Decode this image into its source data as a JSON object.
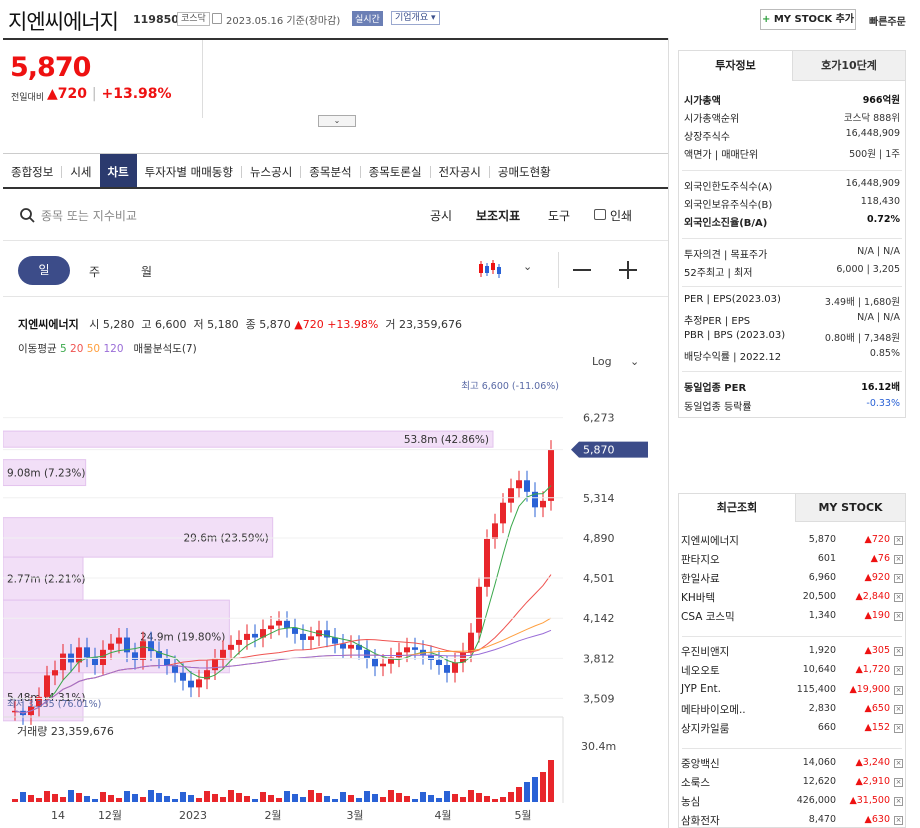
{
  "header": {
    "stock_name": "지엔씨에너지",
    "stock_code": "119850",
    "market_tag": "코스닥",
    "date_text": "2023.05.16  기준(장마감)",
    "realtime_badge": "실시간",
    "company_overview": "기업개요",
    "my_stock_add": "MY STOCK 추가",
    "quick_order": "빠른주문"
  },
  "price": {
    "current": "5,870",
    "change_label": "전일대비",
    "change_amount": "720",
    "change_pct": "+13.98%"
  },
  "tabs": [
    "종합정보",
    "시세",
    "차트",
    "투자자별 매매동향",
    "뉴스공시",
    "종목분석",
    "종목토론실",
    "전자공시",
    "공매도현황"
  ],
  "active_tab": "차트",
  "search": {
    "placeholder": "종목 또는 지수비교"
  },
  "toolbar": {
    "disclosure": "공시",
    "indicator": "보조지표",
    "tools": "도구",
    "print": "인쇄"
  },
  "periods": [
    "일",
    "주",
    "월"
  ],
  "ohlc": {
    "name": "지엔씨에너지",
    "open_label": "시",
    "open": "5,280",
    "high_label": "고",
    "high": "6,600",
    "low_label": "저",
    "low": "5,180",
    "close_label": "종",
    "close": "5,870",
    "chg": "▲720",
    "pct": "+13.98%",
    "vol_label": "거",
    "volume": "23,359,676"
  },
  "ma": {
    "label": "이동평균",
    "p5": "5",
    "p20": "20",
    "p50": "50",
    "p120": "120",
    "vp": "매물분석도(7)"
  },
  "chart_data": {
    "type": "candlestick",
    "scale": "Log",
    "y_ticks": [
      "6,273",
      "5,870",
      "5,314",
      "4,890",
      "4,501",
      "4,142",
      "3,812",
      "3,509"
    ],
    "last_price_label": "5,870",
    "high_annotation": "최고 6,600 (-11.06%)",
    "low_annotation": "최저 3,335 (76.01%)",
    "x_ticks": [
      "14",
      "12월",
      "2023",
      "2월",
      "3월",
      "4월",
      "5월"
    ],
    "volume_label": "거래량 23,359,676",
    "volume_axis": "30.4m",
    "volume_profile": [
      {
        "label": "53.8m (42.86%)",
        "price_low": 5900,
        "price_high": 6100,
        "fraction": 0.4286
      },
      {
        "label": "9.08m (7.23%)",
        "price_low": 5450,
        "price_high": 5750,
        "fraction": 0.0723
      },
      {
        "label": "29.6m (23.59%)",
        "price_low": 4700,
        "price_high": 5100,
        "fraction": 0.2359
      },
      {
        "label": "2.77m (2.21%)",
        "price_low": 4300,
        "price_high": 4700,
        "fraction": 0.0221
      },
      {
        "label": "24.9m (19.80%)",
        "price_low": 3700,
        "price_high": 4300,
        "fraction": 0.198
      },
      {
        "label": "5.48m (4.31%)",
        "price_low": 3350,
        "price_high": 3700,
        "fraction": 0.0431
      }
    ],
    "candles": [
      3420,
      3390,
      3450,
      3520,
      3680,
      3720,
      3850,
      3780,
      3900,
      3820,
      3760,
      3880,
      3930,
      3980,
      3860,
      3800,
      3950,
      3870,
      3810,
      3760,
      3700,
      3640,
      3590,
      3650,
      3720,
      3810,
      3880,
      3920,
      3960,
      4010,
      3980,
      4050,
      4080,
      4120,
      4060,
      4010,
      3960,
      3990,
      4040,
      3980,
      3930,
      3890,
      3920,
      3880,
      3810,
      3750,
      3770,
      3820,
      3860,
      3900,
      3880,
      3840,
      3800,
      3760,
      3700,
      3780,
      3860,
      4020,
      4420,
      4880,
      5040,
      5260,
      5420,
      5510,
      5380,
      5210,
      5280,
      5870
    ]
  },
  "colors": {
    "up": "#e8262b",
    "down": "#2a62d6",
    "ma5": "#3aa84b",
    "ma20": "#ef5350",
    "ma50": "#ff9f3f",
    "ma120": "#9a6dd7",
    "profile": "#f2dff7"
  },
  "sidebar": {
    "tabs": [
      "투자정보",
      "호가10단계"
    ],
    "info": [
      {
        "k": "시가총액",
        "v": "966억원",
        "bold": true
      },
      {
        "k": "시가총액순위",
        "v": "코스닥 888위"
      },
      {
        "k": "상장주식수",
        "v": "16,448,909"
      },
      {
        "k": "액면가 | 매매단위",
        "v": "500원  |  1주"
      },
      {
        "k": "외국인한도주식수(A)",
        "v": "16,448,909"
      },
      {
        "k": "외국인보유주식수(B)",
        "v": "118,430"
      },
      {
        "k": "외국인소진율(B/A)",
        "v": "0.72%",
        "bold": true
      },
      {
        "k": "투자의견 | 목표주가",
        "v": "N/A  |  N/A"
      },
      {
        "k": "52주최고 | 최저",
        "v": "6,000  |  3,205"
      },
      {
        "k": "PER | EPS(2023.03)",
        "v": "3.49배  |  1,680원"
      },
      {
        "k": "추정PER | EPS",
        "v": "N/A  |  N/A"
      },
      {
        "k": "PBR | BPS (2023.03)",
        "v": "0.80배  |  7,348원"
      },
      {
        "k": "배당수익률 | 2022.12",
        "v": "0.85%"
      },
      {
        "k": "동일업종 PER",
        "v": "16.12배",
        "bold": true
      },
      {
        "k": "동일업종 등락률",
        "v": "-0.33%",
        "blue": true
      }
    ],
    "recent_tabs": [
      "최근조회",
      "MY STOCK"
    ],
    "recent": [
      {
        "name": "지엔씨에너지",
        "price": "5,870",
        "chg": "720"
      },
      {
        "name": "판타지오",
        "price": "601",
        "chg": "76"
      },
      {
        "name": "한일사료",
        "price": "6,960",
        "chg": "920"
      },
      {
        "name": "KH바텍",
        "price": "20,500",
        "chg": "2,840"
      },
      {
        "name": "CSA 코스믹",
        "price": "1,340",
        "chg": "190"
      },
      {
        "name": "우진비앤지",
        "price": "1,920",
        "chg": "305"
      },
      {
        "name": "네오오토",
        "price": "10,640",
        "chg": "1,720"
      },
      {
        "name": "JYP Ent.",
        "price": "115,400",
        "chg": "19,900"
      },
      {
        "name": "메타바이오메..",
        "price": "2,830",
        "chg": "650"
      },
      {
        "name": "상지카일룸",
        "price": "660",
        "chg": "152"
      },
      {
        "name": "중앙백신",
        "price": "14,060",
        "chg": "3,240"
      },
      {
        "name": "소룩스",
        "price": "12,620",
        "chg": "2,910"
      },
      {
        "name": "농심",
        "price": "426,000",
        "chg": "31,500"
      },
      {
        "name": "삼화전자",
        "price": "8,470",
        "chg": "630"
      }
    ]
  }
}
